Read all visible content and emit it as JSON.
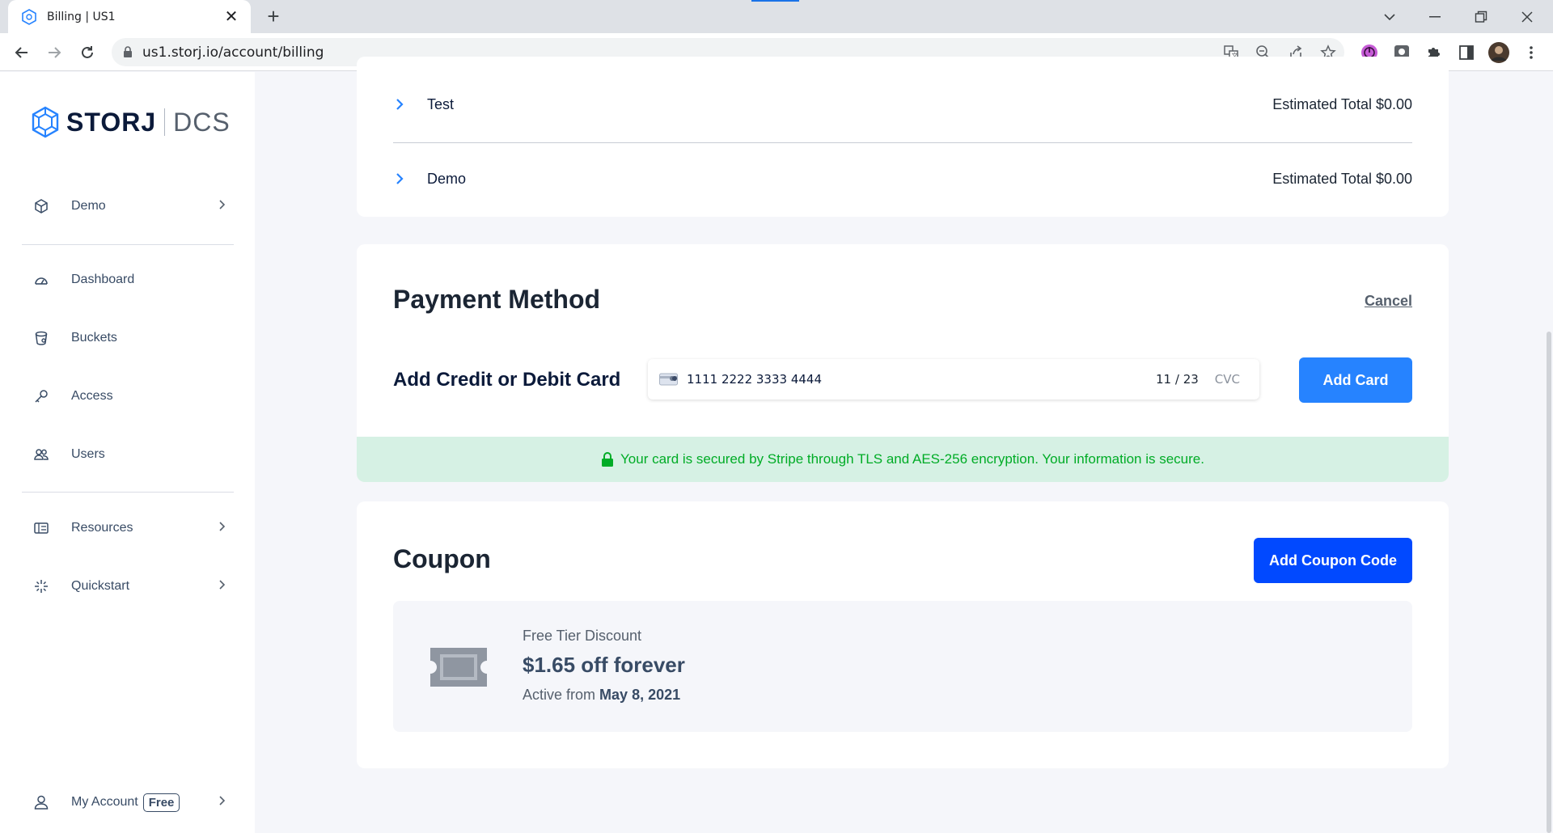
{
  "browser": {
    "tab_title": "Billing | US1",
    "tab_close": "✕",
    "new_tab": "+",
    "url": "us1.storj.io/account/billing"
  },
  "sidebar": {
    "brand": "STORJ",
    "product": "DCS",
    "project_selector": "Demo",
    "items": [
      {
        "label": "Dashboard",
        "icon": "dashboard-icon"
      },
      {
        "label": "Buckets",
        "icon": "bucket-icon"
      },
      {
        "label": "Access",
        "icon": "key-icon"
      },
      {
        "label": "Users",
        "icon": "users-icon"
      }
    ],
    "resources": "Resources",
    "quickstart": "Quickstart",
    "account": "My Account",
    "account_badge": "Free"
  },
  "projects": [
    {
      "name": "Test",
      "total": "Estimated Total $0.00"
    },
    {
      "name": "Demo",
      "total": "Estimated Total $0.00"
    }
  ],
  "payment": {
    "title": "Payment Method",
    "cancel": "Cancel",
    "add_card_label": "Add Credit or Debit Card",
    "card_number": "1111 2222 3333 4444",
    "expiry": "11 / 23",
    "cvc_placeholder": "CVC",
    "add_card_button": "Add Card",
    "secure_text": "Your card is secured by Stripe through TLS and AES-256 encryption. Your information is secure."
  },
  "coupon": {
    "title": "Coupon",
    "add_button": "Add Coupon Code",
    "name": "Free Tier Discount",
    "value": "$1.65 off forever",
    "active_prefix": "Active from",
    "active_date": "May 8, 2021"
  },
  "colors": {
    "accent": "#2683ff",
    "coupon_button": "#0149ff",
    "secure_bg": "#d6f1e4",
    "secure_text": "#00ac26"
  }
}
